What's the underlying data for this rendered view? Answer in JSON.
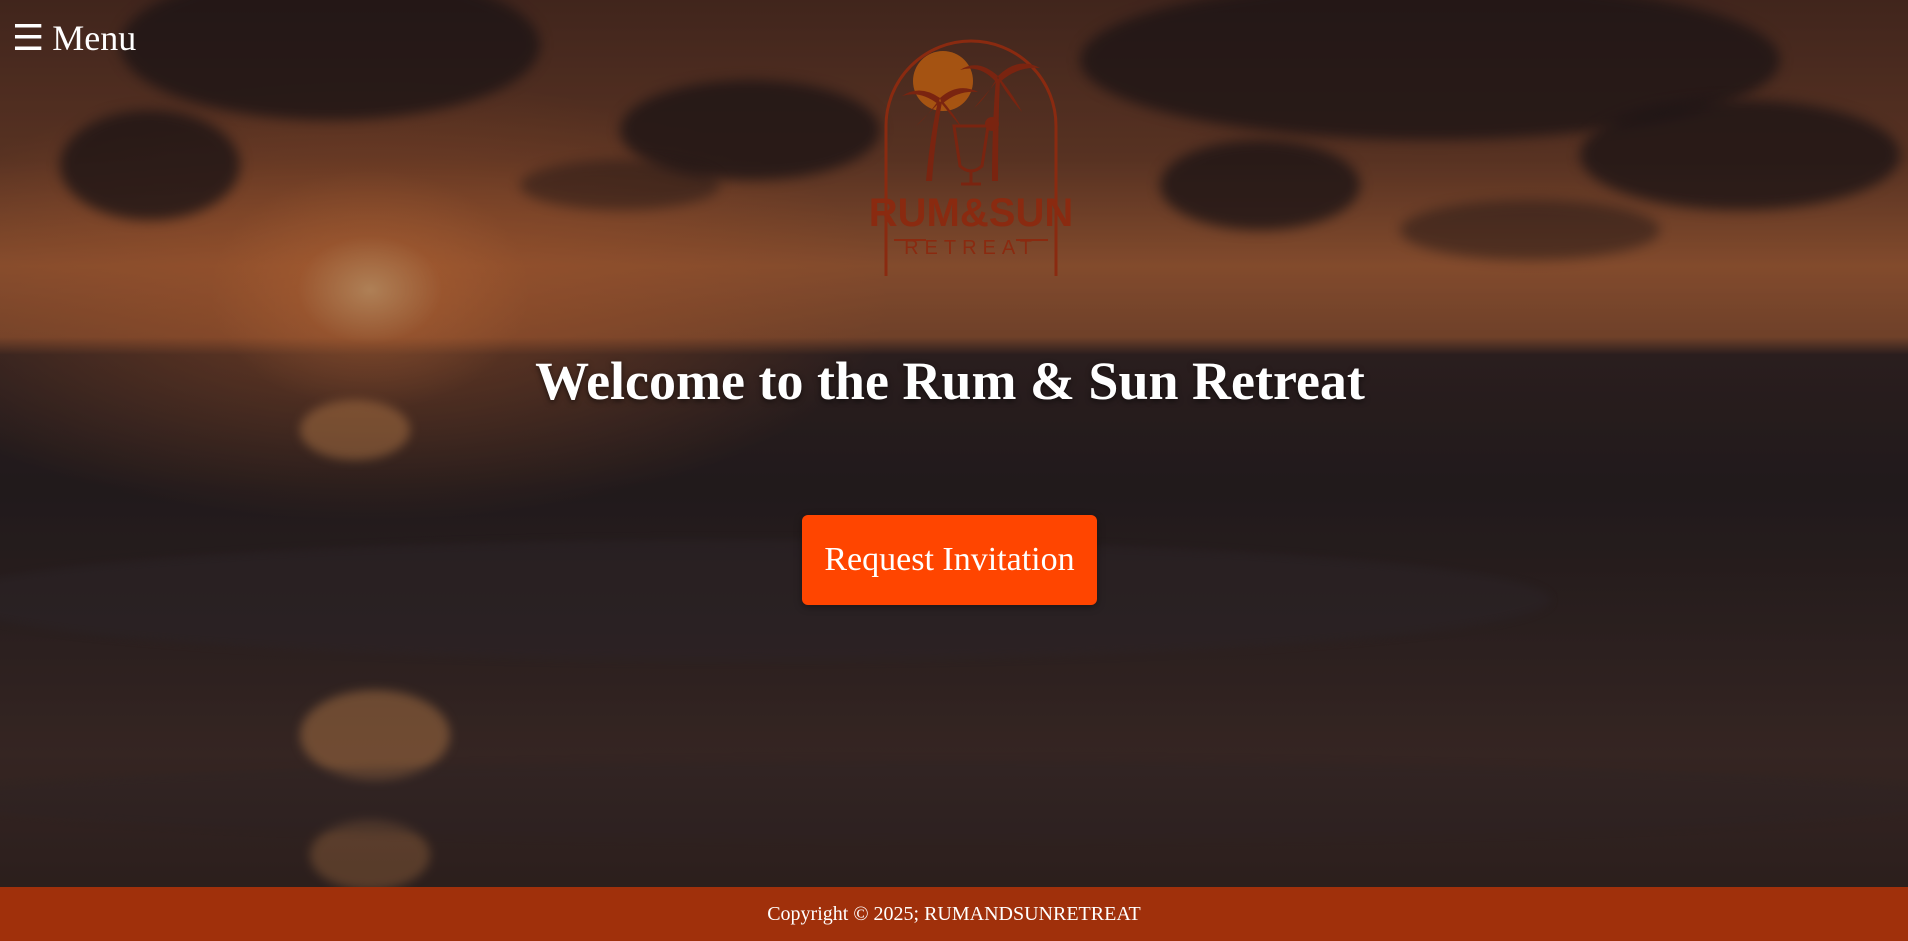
{
  "nav": {
    "menu_icon": "☰",
    "menu_label": "Menu"
  },
  "logo": {
    "name_line": "RUM&SUN",
    "sub_line": "RETREAT",
    "icon": "palm-trees-cocktail-sun-logo"
  },
  "hero": {
    "headline": "Welcome to the Rum & Sun Retreat",
    "cta_label": "Request Invitation"
  },
  "footer": {
    "copyright": "Copyright © 2025; RUMANDSUNRETREAT"
  },
  "colors": {
    "cta": "#ff4500",
    "footer": "#a0300b",
    "logo": "#8a2a10"
  }
}
